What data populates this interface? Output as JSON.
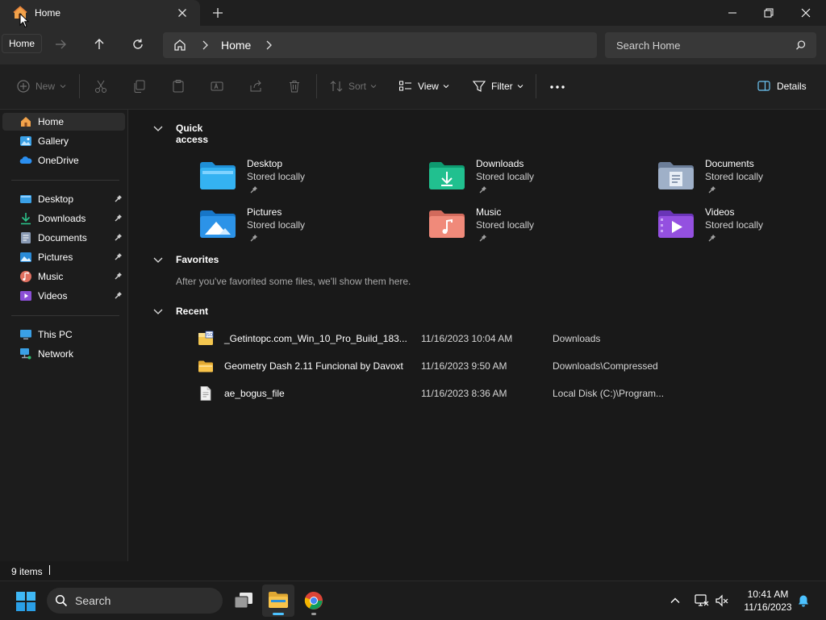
{
  "window": {
    "tab_title": "Home",
    "tooltip": "Home"
  },
  "navbar": {
    "breadcrumb_home": "Home",
    "search_placeholder": "Search Home"
  },
  "toolbar": {
    "new_label": "New",
    "sort_label": "Sort",
    "view_label": "View",
    "filter_label": "Filter",
    "details_label": "Details"
  },
  "sidebar": {
    "top": [
      {
        "label": "Home",
        "icon": "home-icon"
      },
      {
        "label": "Gallery",
        "icon": "gallery-icon"
      },
      {
        "label": "OneDrive",
        "icon": "onedrive-icon"
      }
    ],
    "pinned": [
      {
        "label": "Desktop",
        "icon": "desktop-icon"
      },
      {
        "label": "Downloads",
        "icon": "downloads-icon"
      },
      {
        "label": "Documents",
        "icon": "documents-icon"
      },
      {
        "label": "Pictures",
        "icon": "pictures-icon"
      },
      {
        "label": "Music",
        "icon": "music-icon"
      },
      {
        "label": "Videos",
        "icon": "videos-icon"
      }
    ],
    "devices": [
      {
        "label": "This PC",
        "icon": "this-pc-icon"
      },
      {
        "label": "Network",
        "icon": "network-icon"
      }
    ]
  },
  "main": {
    "quick_access_title": "Quick access",
    "quick_access": [
      {
        "name": "Desktop",
        "sub": "Stored locally",
        "icon": "desktop-folder-icon"
      },
      {
        "name": "Downloads",
        "sub": "Stored locally",
        "icon": "downloads-folder-icon"
      },
      {
        "name": "Documents",
        "sub": "Stored locally",
        "icon": "documents-folder-icon"
      },
      {
        "name": "Pictures",
        "sub": "Stored locally",
        "icon": "pictures-folder-icon"
      },
      {
        "name": "Music",
        "sub": "Stored locally",
        "icon": "music-folder-icon"
      },
      {
        "name": "Videos",
        "sub": "Stored locally",
        "icon": "videos-folder-icon"
      }
    ],
    "favorites_title": "Favorites",
    "favorites_empty": "After you've favorited some files, we'll show them here.",
    "recent_title": "Recent",
    "recent": [
      {
        "name": "_Getintopc.com_Win_10_Pro_Build_183...",
        "date": "11/16/2023 10:04 AM",
        "location": "Downloads",
        "icon": "iso-file-icon"
      },
      {
        "name": "Geometry Dash 2.11 Funcional by Davoxt",
        "date": "11/16/2023 9:50 AM",
        "location": "Downloads\\Compressed",
        "icon": "folder-icon"
      },
      {
        "name": "ae_bogus_file",
        "date": "11/16/2023 8:36 AM",
        "location": "Local Disk (C:)\\Program...",
        "icon": "file-icon"
      }
    ]
  },
  "status": {
    "item_count": "9 items"
  },
  "taskbar": {
    "search_label": "Search",
    "time": "10:41 AM",
    "date": "11/16/2023"
  },
  "colors": {
    "accent": "#4cc2ff",
    "window_bg": "#191919",
    "folder_yellow": "#f8c34a"
  }
}
